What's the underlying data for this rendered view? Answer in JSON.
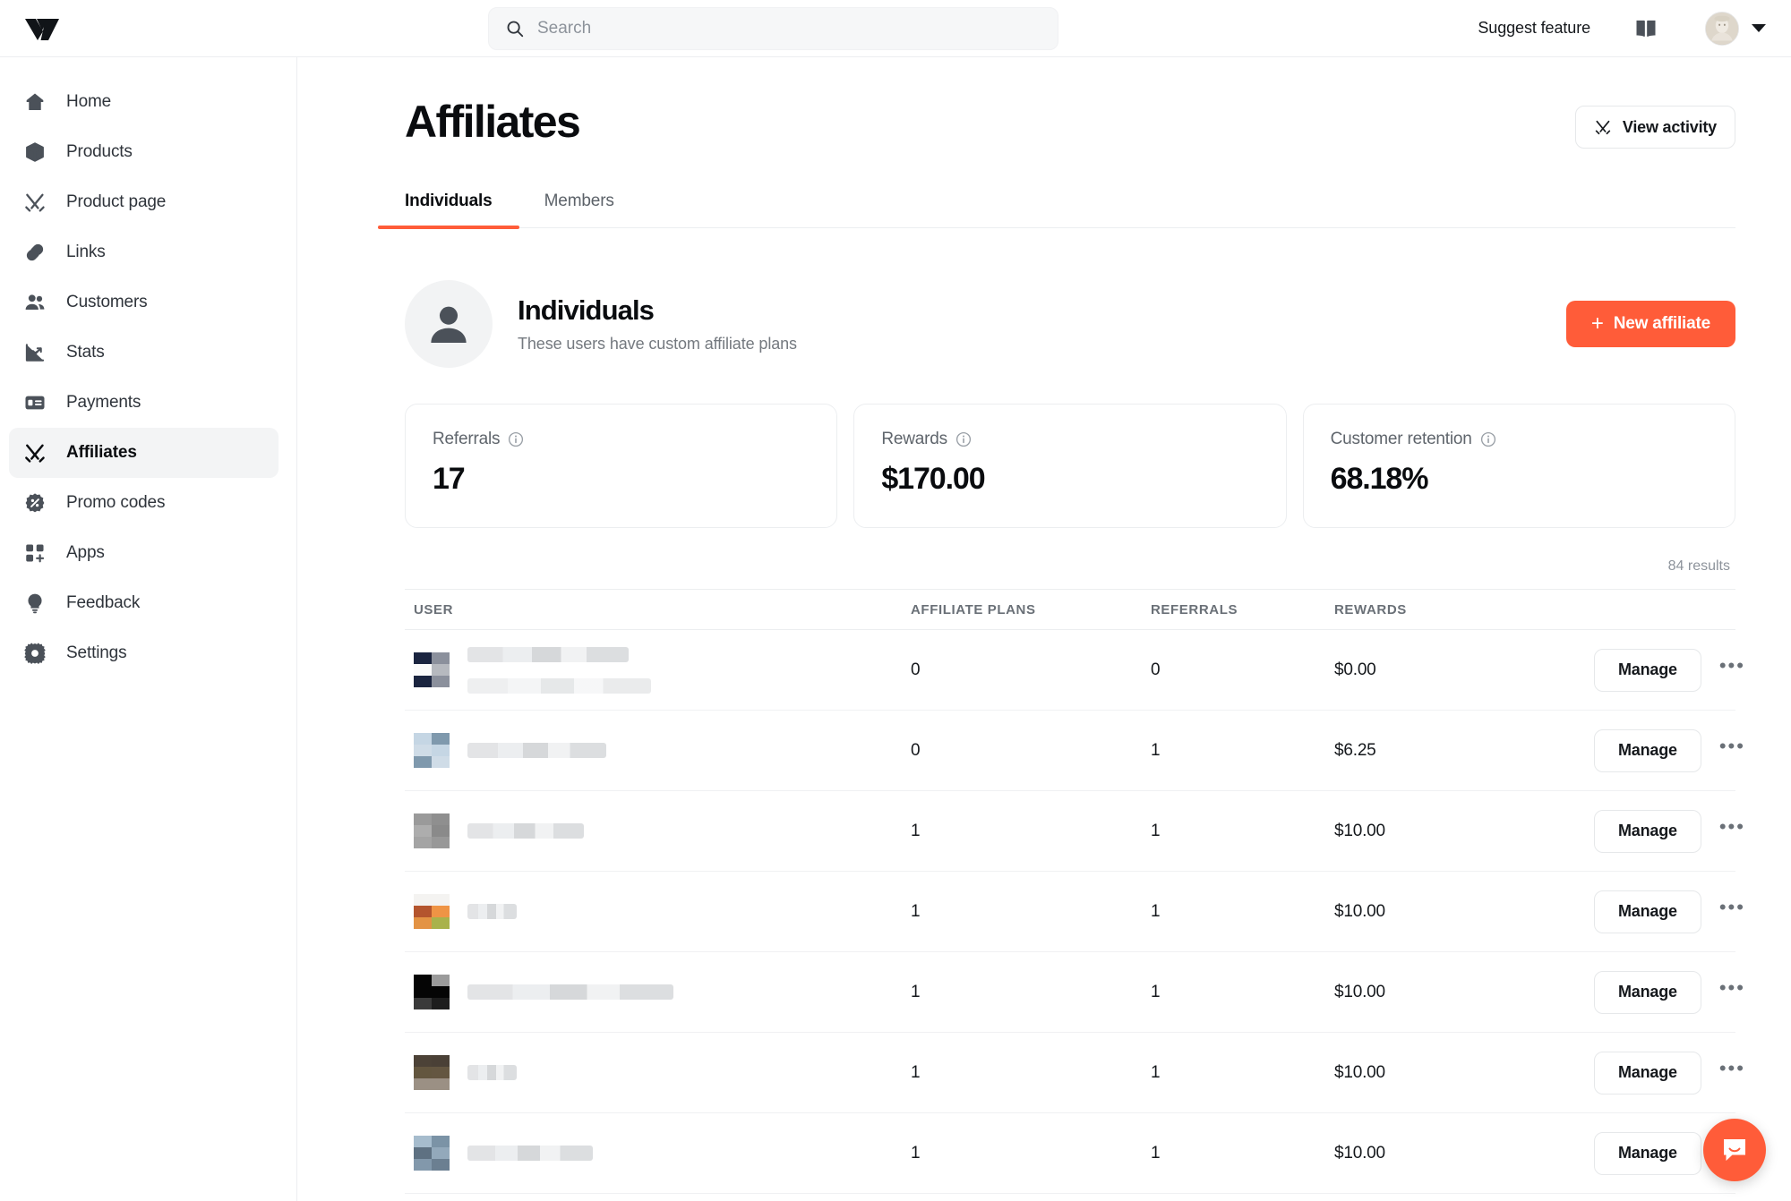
{
  "colors": {
    "accent": "#ff5c39",
    "text": "#15181c",
    "muted": "#74797f",
    "border": "#eceef0"
  },
  "topbar": {
    "logo_name": "whop-logo",
    "search": {
      "placeholder": "Search",
      "value": ""
    },
    "suggest_feature": "Suggest feature",
    "book_icon": "book-icon",
    "avatar_icon": "user-avatar",
    "caret_icon": "chevron-down-icon"
  },
  "sidebar": {
    "items": [
      {
        "label": "Home",
        "icon": "home-icon",
        "active": false
      },
      {
        "label": "Products",
        "icon": "box-icon",
        "active": false
      },
      {
        "label": "Product page",
        "icon": "swords-icon",
        "active": false
      },
      {
        "label": "Links",
        "icon": "link-icon",
        "active": false
      },
      {
        "label": "Customers",
        "icon": "people-icon",
        "active": false
      },
      {
        "label": "Stats",
        "icon": "chart-icon",
        "active": false
      },
      {
        "label": "Payments",
        "icon": "card-icon",
        "active": false
      },
      {
        "label": "Affiliates",
        "icon": "swords-icon",
        "active": true
      },
      {
        "label": "Promo codes",
        "icon": "percent-badge-icon",
        "active": false
      },
      {
        "label": "Apps",
        "icon": "apps-plus-icon",
        "active": false
      },
      {
        "label": "Feedback",
        "icon": "lightbulb-icon",
        "active": false
      },
      {
        "label": "Settings",
        "icon": "gear-icon",
        "active": false
      }
    ]
  },
  "page": {
    "title": "Affiliates",
    "view_activity": "View activity",
    "tabs": [
      {
        "label": "Individuals",
        "active": true
      },
      {
        "label": "Members",
        "active": false
      }
    ]
  },
  "section": {
    "title": "Individuals",
    "subtitle": "These users have custom affiliate plans",
    "new_affiliate": "New affiliate",
    "plus_glyph": "+"
  },
  "stats": [
    {
      "label": "Referrals",
      "value": "17"
    },
    {
      "label": "Rewards",
      "value": "$170.00"
    },
    {
      "label": "Customer retention",
      "value": "68.18%"
    }
  ],
  "table": {
    "results_count": "84 results",
    "columns": [
      "USER",
      "AFFILIATE PLANS",
      "REFERRALS",
      "REWARDS"
    ],
    "manage_label": "Manage",
    "more_glyph": "•••",
    "rows": [
      {
        "user_redacted": true,
        "avatar_colors": [
          "#1b2540",
          "#8b909c",
          "#fbfbfb",
          "#b6b9bf",
          "#1b2540",
          "#8b909c"
        ],
        "name_width": 180,
        "sub_width": 205,
        "plans": "0",
        "referrals": "0",
        "rewards": "$0.00"
      },
      {
        "user_redacted": true,
        "avatar_colors": [
          "#c5d6e4",
          "#7f99ad",
          "#cfdce7",
          "#c5d6e4",
          "#7f99ad",
          "#cfdce7"
        ],
        "name_width": 155,
        "sub_width": 0,
        "plans": "0",
        "referrals": "1",
        "rewards": "$6.25"
      },
      {
        "user_redacted": true,
        "avatar_colors": [
          "#9a9a9a",
          "#8f8f8f",
          "#adadad",
          "#8a8a8a",
          "#a4a4a4",
          "#989898"
        ],
        "name_width": 130,
        "sub_width": 0,
        "plans": "1",
        "referrals": "1",
        "rewards": "$10.00"
      },
      {
        "user_redacted": true,
        "avatar_colors": [
          "#f4f3f1",
          "#f4f3f1",
          "#b4552e",
          "#ef9445",
          "#e39344",
          "#a9b24b"
        ],
        "name_width": 55,
        "sub_width": 0,
        "plans": "1",
        "referrals": "1",
        "rewards": "$10.00"
      },
      {
        "user_redacted": true,
        "avatar_colors": [
          "#050505",
          "#9b9b9b",
          "#050505",
          "#050505",
          "#3a3a3a",
          "#1d1d1d"
        ],
        "name_width": 230,
        "sub_width": 0,
        "plans": "1",
        "referrals": "1",
        "rewards": "$10.00"
      },
      {
        "user_redacted": true,
        "avatar_colors": [
          "#4c4237",
          "#4a4036",
          "#63563f",
          "#645641",
          "#9b9084",
          "#9b9084"
        ],
        "name_width": 55,
        "sub_width": 0,
        "plans": "1",
        "referrals": "1",
        "rewards": "$10.00"
      },
      {
        "user_redacted": true,
        "avatar_colors": [
          "#a6bccd",
          "#7b93a6",
          "#5e7182",
          "#93a9bb",
          "#8298ab",
          "#6b7f91"
        ],
        "name_width": 140,
        "sub_width": 0,
        "plans": "1",
        "referrals": "1",
        "rewards": "$10.00"
      }
    ]
  },
  "intercom": {
    "icon": "chat-bubble-icon"
  }
}
